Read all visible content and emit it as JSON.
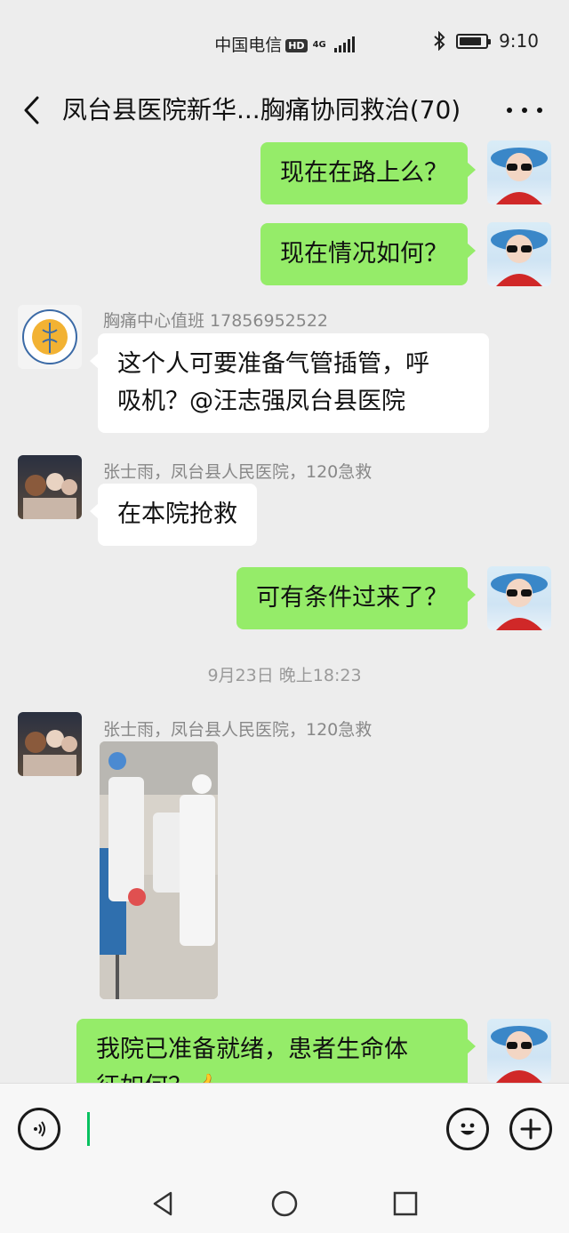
{
  "status_bar": {
    "carrier": "中国电信",
    "hd_badge": "HD",
    "network": "4G",
    "time": "9:10",
    "bluetooth_icon": "bluetooth-icon",
    "battery_level": 0.85
  },
  "header": {
    "title": "凤台县医院新华...胸痛协同救治(70)",
    "back_icon": "back-arrow-icon",
    "more_icon": "more-dots-icon"
  },
  "messages": [
    {
      "side": "me",
      "text": "现在在路上么？"
    },
    {
      "side": "me",
      "text": "现在情况如何？"
    },
    {
      "side": "them",
      "sender": "胸痛中心值班 17856952522",
      "text_line1": "这个人可要准备气管插管，呼",
      "text_line2": "吸机？@汪志强凤台县医院"
    },
    {
      "side": "them",
      "sender": "张士雨，凤台县人民医院，120急救",
      "text": "在本院抢救"
    },
    {
      "side": "me",
      "text": "可有条件过来了？"
    },
    {
      "type": "timestamp",
      "text": "9月23日 晚上18:23"
    },
    {
      "side": "them",
      "sender": "张士雨，凤台县人民医院，120急救",
      "type": "image"
    },
    {
      "side": "me",
      "text_line1": "我院已准备就绪，患者生命体",
      "text_line2": "征如何？👍"
    }
  ],
  "input_bar": {
    "voice_icon": "voice-icon",
    "emoji_icon": "emoji-icon",
    "plus_icon": "plus-icon"
  },
  "nav_bar": {
    "back_icon": "nav-back-icon",
    "home_icon": "nav-home-icon",
    "recents_icon": "nav-recents-icon"
  }
}
